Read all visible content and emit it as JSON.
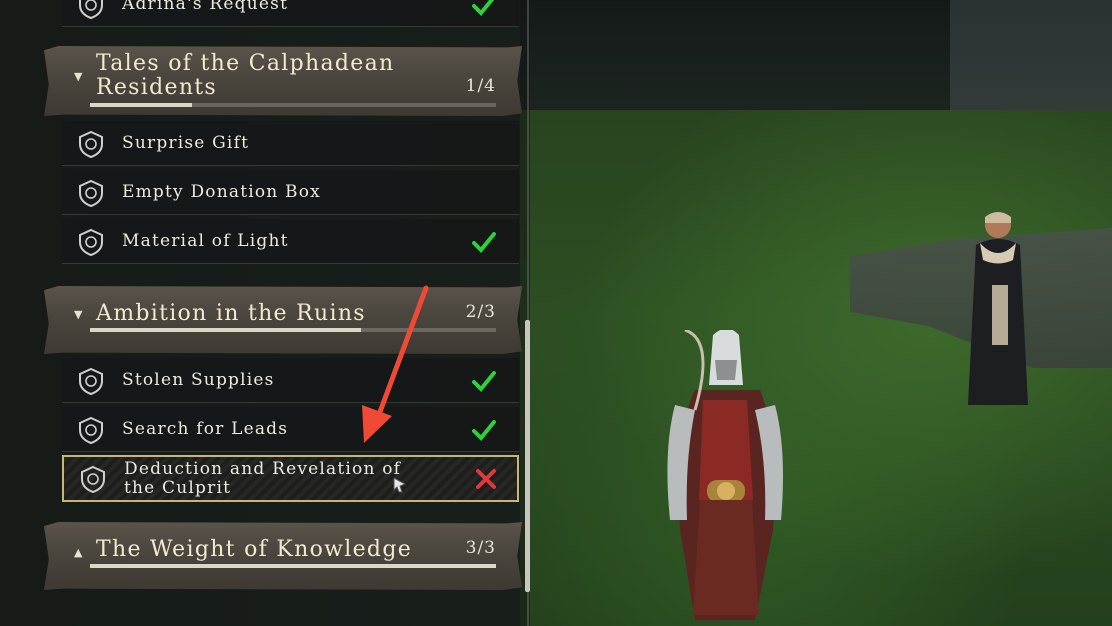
{
  "quest_groups": {
    "top_partial": {
      "items": [
        {
          "label": "Adrina's Request",
          "status": "completed"
        }
      ]
    },
    "calphadean": {
      "title": "Tales of the Calphadean Residents",
      "progress_text": "1/4",
      "progress_fraction": 0.25,
      "expanded": true,
      "items": [
        {
          "label": "Surprise Gift",
          "status": "none"
        },
        {
          "label": "Empty Donation Box",
          "status": "none"
        },
        {
          "label": "Material of Light",
          "status": "completed"
        }
      ]
    },
    "ambition": {
      "title": "Ambition in the Ruins",
      "progress_text": "2/3",
      "progress_fraction": 0.667,
      "expanded": true,
      "items": [
        {
          "label": "Stolen Supplies",
          "status": "completed"
        },
        {
          "label": "Search for Leads",
          "status": "completed"
        },
        {
          "label": "Deduction and Revelation of the Culprit",
          "status": "failed",
          "selected": true
        }
      ]
    },
    "weight": {
      "title": "The Weight of Knowledge",
      "progress_text": "3/3",
      "progress_fraction": 1.0,
      "expanded": false
    }
  },
  "icons": {
    "quest_emblem": "shield-crest-icon",
    "completed": "check-icon",
    "failed": "x-mark-icon",
    "expanded": "caret-down-icon",
    "collapsed": "caret-up-icon"
  },
  "colors": {
    "check": "#2fd03a",
    "fail": "#e0393b",
    "selected_border": "#c8b57a",
    "annotation_arrow": "#f04a37"
  }
}
